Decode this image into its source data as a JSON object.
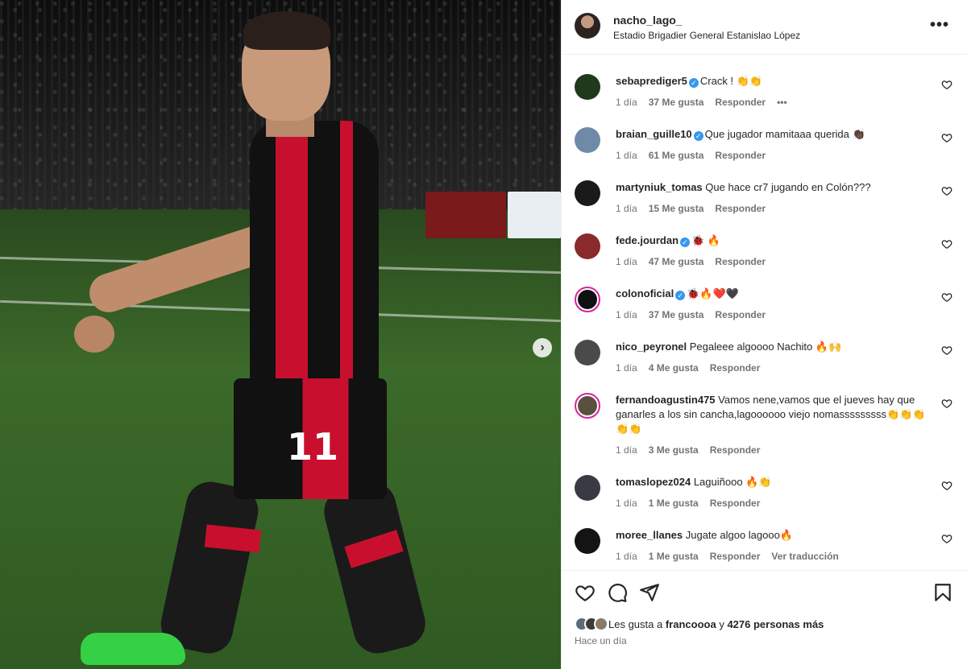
{
  "post": {
    "username": "nacho_lago_",
    "location": "Estadio Brigadier General Estanislao López",
    "more_label": "•••",
    "photo_next": "›",
    "jersey_number": "11"
  },
  "comments": [
    {
      "user": "sebaprediger5",
      "verified": true,
      "text": "Crack ! 👏👏",
      "time": "1 día",
      "likes": "37 Me gusta",
      "reply": "Responder",
      "extra": "•••",
      "avatar_color": "#1f3a1a"
    },
    {
      "user": "braian_guille10",
      "verified": true,
      "text": "Que jugador mamitaaa querida 👏🏿",
      "time": "1 día",
      "likes": "61 Me gusta",
      "reply": "Responder",
      "extra": "",
      "avatar_color": "#6f8aa8"
    },
    {
      "user": "martyniuk_tomas",
      "verified": false,
      "text": "Que hace cr7 jugando en Colón???",
      "time": "1 día",
      "likes": "15 Me gusta",
      "reply": "Responder",
      "extra": "",
      "avatar_color": "#1a1a1a"
    },
    {
      "user": "fede.jourdan",
      "verified": true,
      "text": "🐞 🔥",
      "time": "1 día",
      "likes": "47 Me gusta",
      "reply": "Responder",
      "extra": "",
      "avatar_color": "#8a2a2a"
    },
    {
      "user": "colonoficial",
      "verified": true,
      "text": "🐞🔥❤️🖤",
      "time": "1 día",
      "likes": "37 Me gusta",
      "reply": "Responder",
      "extra": "",
      "avatar_color": "#111111"
    },
    {
      "user": "nico_peyronel",
      "verified": false,
      "text": "Pegaleee algoooo Nachito 🔥🙌",
      "time": "1 día",
      "likes": "4 Me gusta",
      "reply": "Responder",
      "extra": "",
      "avatar_color": "#4a4a4a"
    },
    {
      "user": "fernandoagustin475",
      "verified": false,
      "text": "Vamos nene,vamos que el jueves hay que ganarles a los sin cancha,lagoooooo viejo nomasssssssss👏👏👏👏👏",
      "time": "1 día",
      "likes": "3 Me gusta",
      "reply": "Responder",
      "extra": "",
      "avatar_color": "#5a5040"
    },
    {
      "user": "tomaslopez024",
      "verified": false,
      "text": "Laguiñooo 🔥👏",
      "time": "1 día",
      "likes": "1 Me gusta",
      "reply": "Responder",
      "extra": "",
      "avatar_color": "#3a3a44"
    },
    {
      "user": "moree_llanes",
      "verified": false,
      "text": "Jugate algoo lagooo🔥",
      "time": "1 día",
      "likes": "1 Me gusta",
      "reply": "Responder",
      "extra": "Ver traducción",
      "avatar_color": "#141414"
    }
  ],
  "footer": {
    "likes_prefix": "Les gusta a",
    "likes_user": "francoooa",
    "likes_and": "y",
    "likes_count": "4276 personas más",
    "time_ago": "Hace un día"
  },
  "colors": {
    "verified": "#3897f0",
    "club_red": "#c8102e",
    "text": "#262626",
    "muted": "#737373"
  }
}
